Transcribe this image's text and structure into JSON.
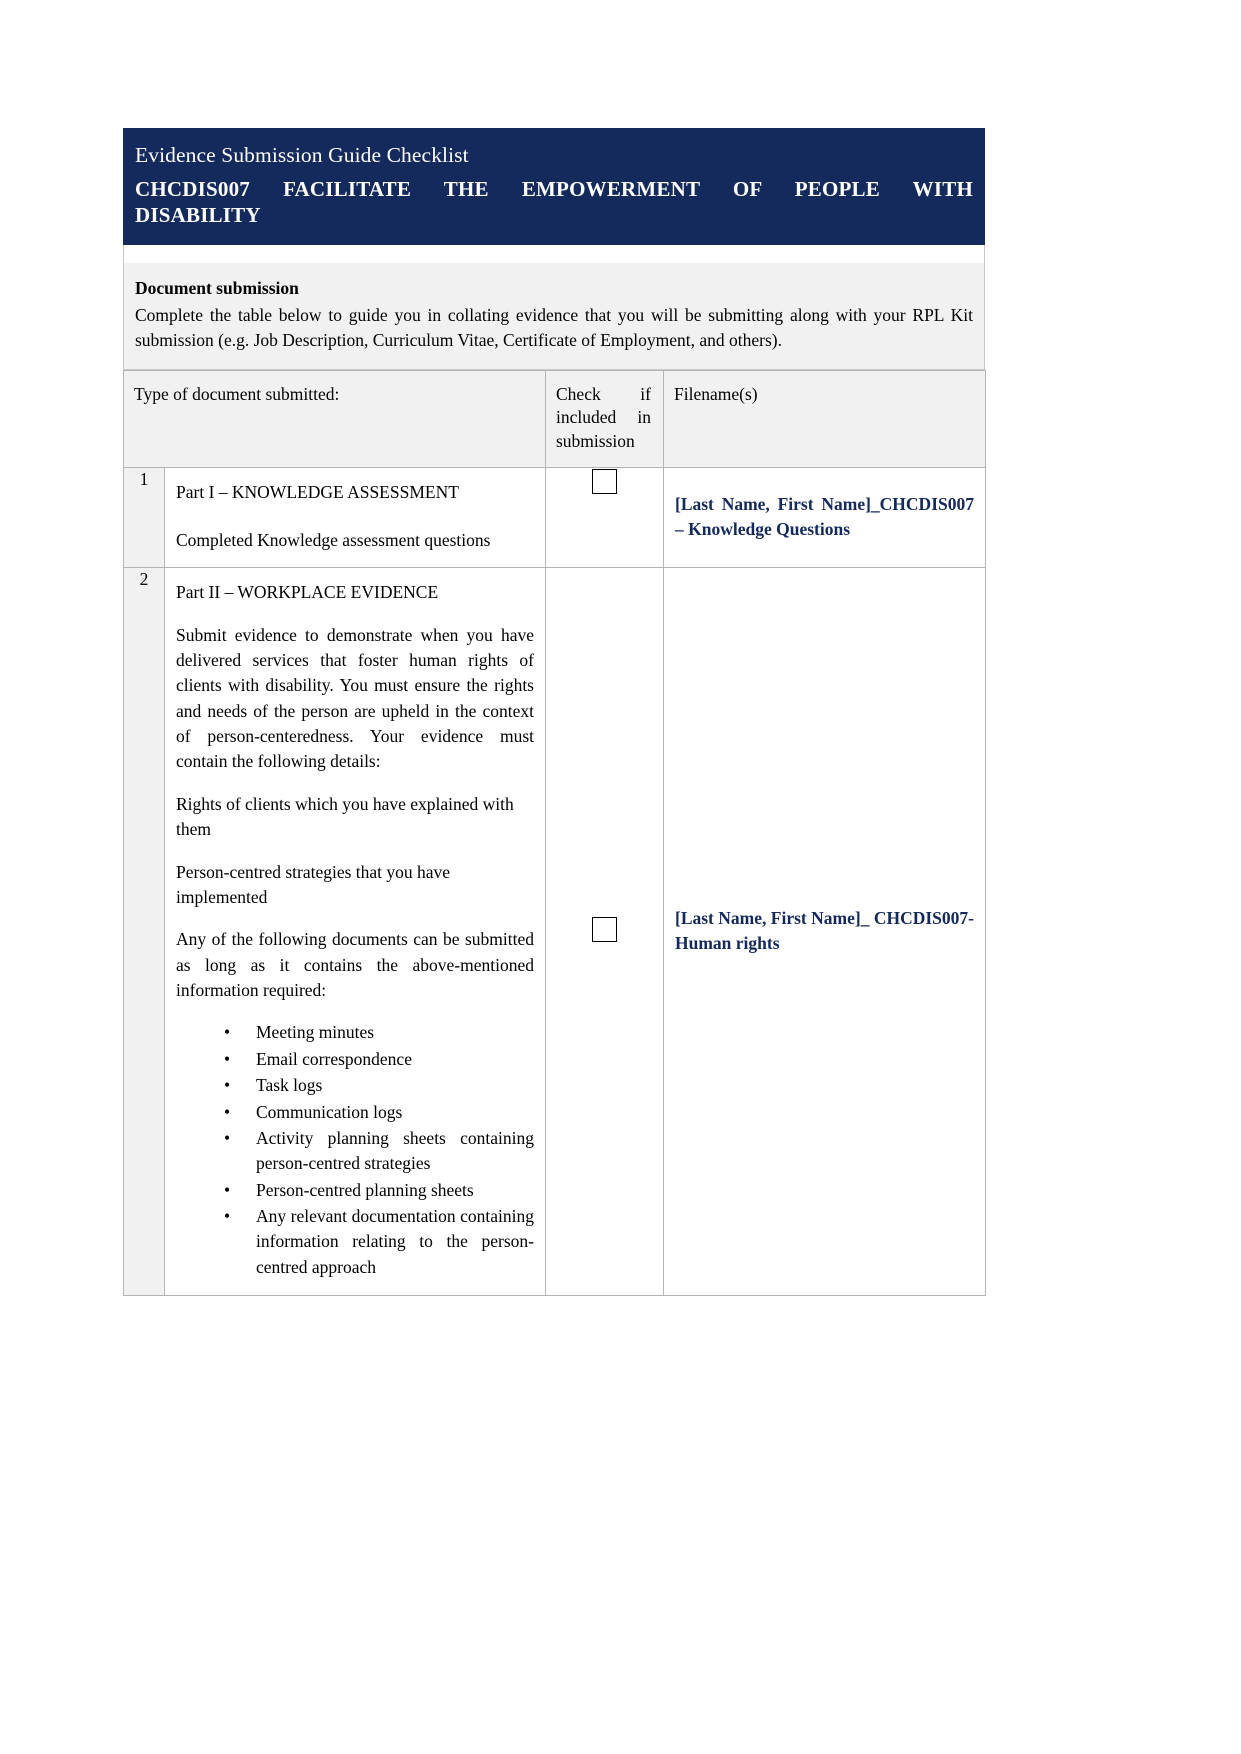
{
  "banner": {
    "subtitle": "Evidence Submission Guide Checklist",
    "title_line1": "CHCDIS007   FACILITATE   THE   EMPOWERMENT   OF   PEOPLE   WITH",
    "title_line2": "DISABILITY",
    "background_color": "#14295c",
    "text_color": "#ffffff"
  },
  "intro": {
    "heading": "Document submission",
    "body": "Complete the table below to guide you in collating evidence that you will be submitting along with your RPL Kit submission (e.g. Job Description, Curriculum Vitae, Certificate of Employment, and others)."
  },
  "table": {
    "headers": {
      "number": "",
      "type": "Type of document submitted:",
      "check": "Check if included in submission",
      "filename": "Filename(s)"
    },
    "accent_color": "#14295c",
    "rows": [
      {
        "number": "1",
        "title": "Part I – KNOWLEDGE ASSESSMENT",
        "detail": "Completed Knowledge assessment questions",
        "checkbox_checked": false,
        "checkbox_name": "row-1-include-checkbox",
        "filename": "[Last Name, First Name]_CHCDIS007 – Knowledge Questions"
      },
      {
        "number": "2",
        "title": "Part II – WORKPLACE EVIDENCE",
        "paragraphs": [
          "Submit evidence to demonstrate when you have delivered services that foster human rights of clients with disability. You must ensure the rights and needs of the person are upheld in the context of person-centeredness. Your evidence must contain the following details:",
          "Rights of clients which you have explained with them",
          "Person-centred strategies that you have implemented",
          "Any of the following documents can be submitted as long as it contains the above-mentioned information required:"
        ],
        "bullets": [
          "Meeting minutes",
          "Email correspondence",
          "Task logs",
          "Communication logs",
          "Activity planning sheets containing person-centred strategies",
          "Person-centred planning sheets",
          "Any relevant documentation containing information relating to the person-centred approach"
        ],
        "checkbox_checked": false,
        "checkbox_name": "row-2-include-checkbox",
        "filename": "[Last Name, First Name]_ CHCDIS007-Human rights"
      }
    ]
  }
}
